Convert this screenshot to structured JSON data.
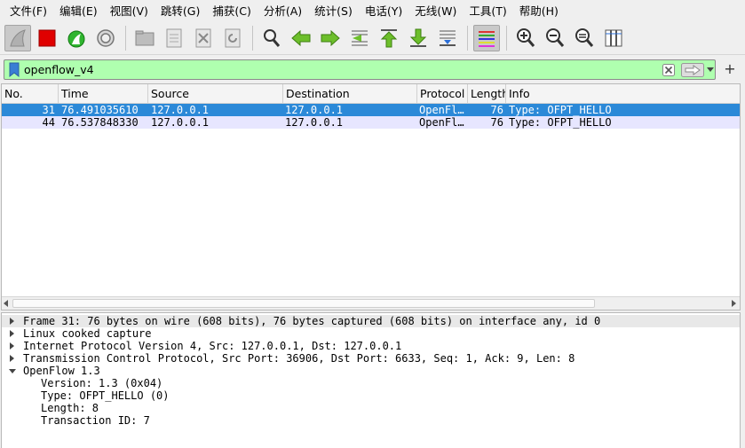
{
  "menu": [
    "文件(F)",
    "编辑(E)",
    "视图(V)",
    "跳转(G)",
    "捕获(C)",
    "分析(A)",
    "统计(S)",
    "电话(Y)",
    "无线(W)",
    "工具(T)",
    "帮助(H)"
  ],
  "filter": {
    "value": "openflow_v4",
    "add_label": "+"
  },
  "columns": [
    "No.",
    "Time",
    "Source",
    "Destination",
    "Protocol",
    "Length",
    "Info"
  ],
  "packets": [
    {
      "no": "31",
      "time": "76.491035610",
      "source": "127.0.0.1",
      "destination": "127.0.0.1",
      "protocol": "OpenFl…",
      "length": "76",
      "info": "Type: OFPT_HELLO"
    },
    {
      "no": "44",
      "time": "76.537848330",
      "source": "127.0.0.1",
      "destination": "127.0.0.1",
      "protocol": "OpenFl…",
      "length": "76",
      "info": "Type: OFPT_HELLO"
    }
  ],
  "details": {
    "frame": "Frame 31: 76 bytes on wire (608 bits), 76 bytes captured (608 bits) on interface any, id 0",
    "linux": "Linux cooked capture",
    "ip": "Internet Protocol Version 4, Src: 127.0.0.1, Dst: 127.0.0.1",
    "tcp": "Transmission Control Protocol, Src Port: 36906, Dst Port: 6633, Seq: 1, Ack: 9, Len: 8",
    "openflow": "OpenFlow 1.3",
    "version": "Version: 1.3 (0x04)",
    "type": "Type: OFPT_HELLO (0)",
    "length": "Length: 8",
    "xid": "Transaction ID: 7"
  },
  "colors": {
    "selected_row": "#2b89d8",
    "alt_row": "#e7e6ff",
    "filter_valid": "#afffaf"
  }
}
